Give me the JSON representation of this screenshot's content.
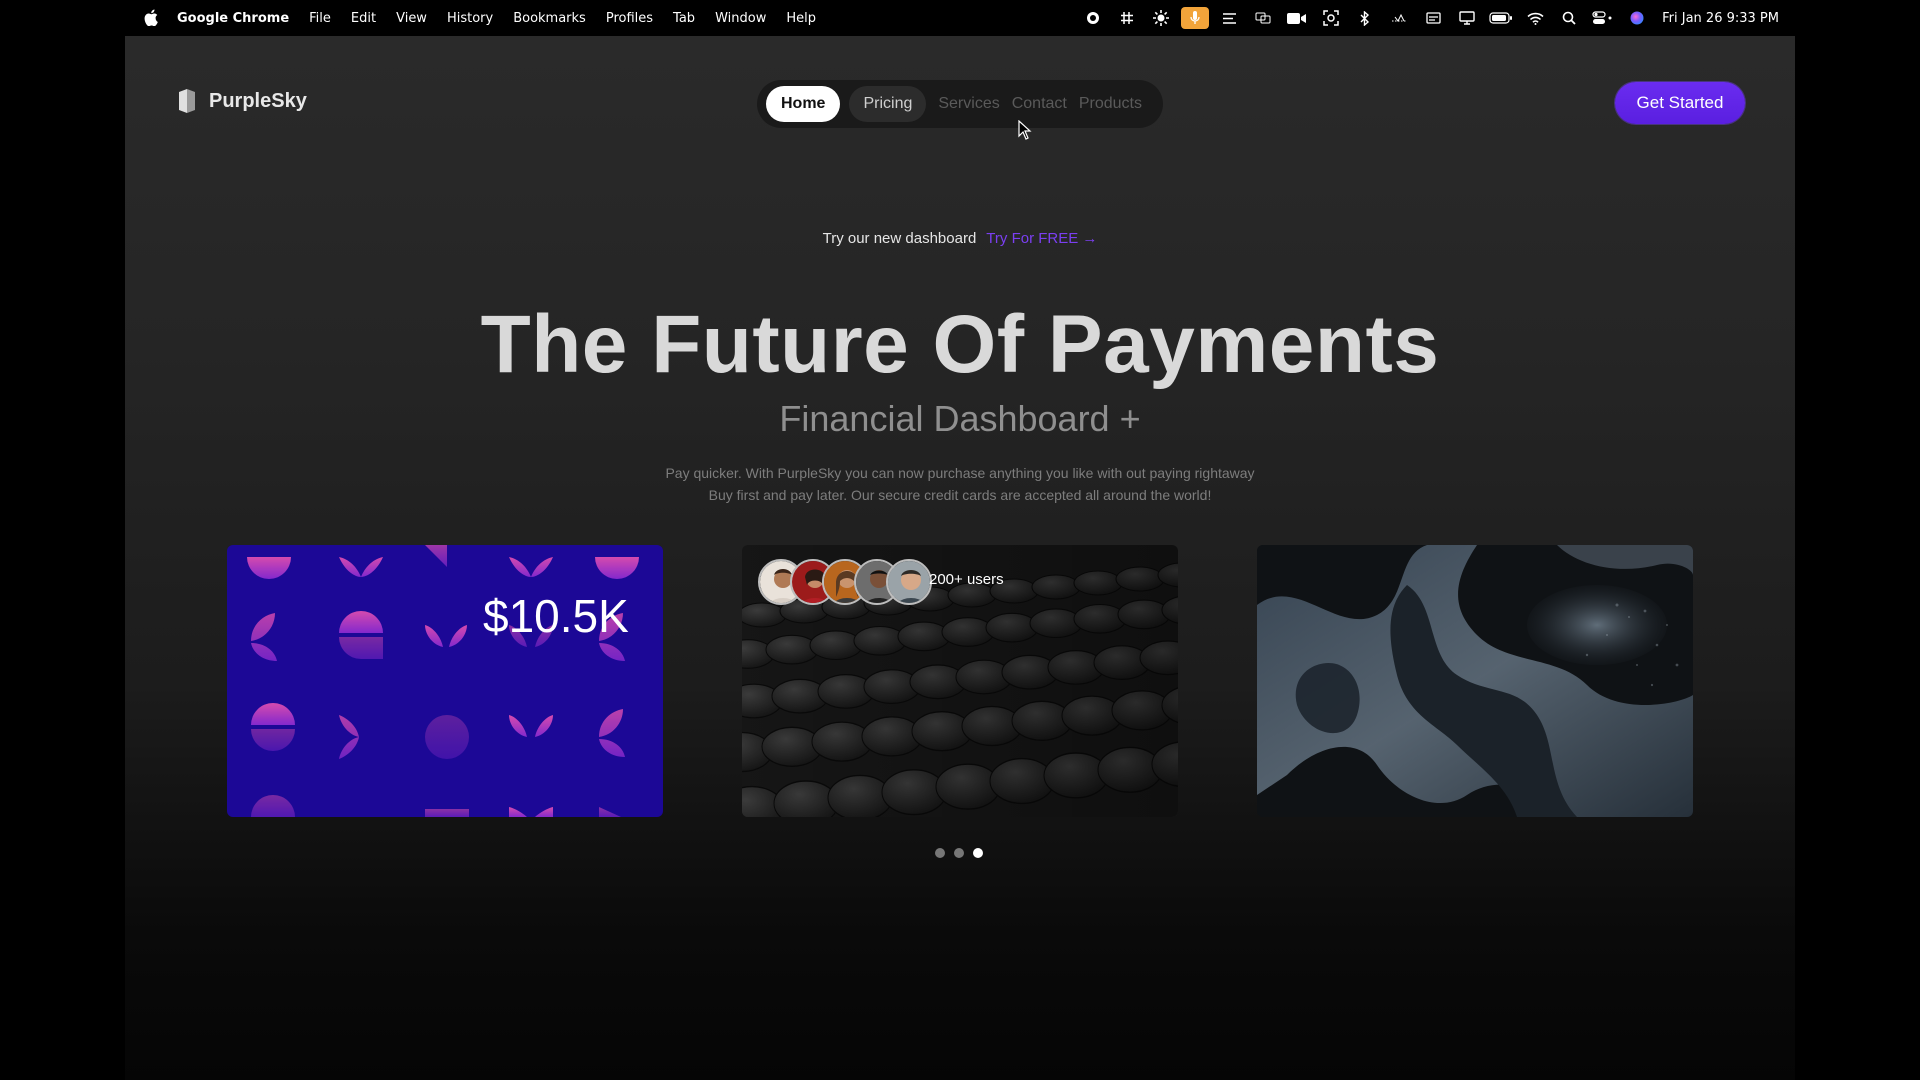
{
  "menubar": {
    "app_name": "Google Chrome",
    "menus": [
      "File",
      "Edit",
      "View",
      "History",
      "Bookmarks",
      "Profiles",
      "Tab",
      "Window",
      "Help"
    ],
    "clock": "Fri Jan 26  9:33 PM",
    "status_icons": [
      "record-icon",
      "hash-icon",
      "gear-sun-icon",
      "microphone-icon",
      "list-icon",
      "mirror-icon",
      "camera-icon",
      "screenshot-icon",
      "bluetooth-icon",
      "dots-icon",
      "display-icon",
      "monitor-icon",
      "battery-icon",
      "wifi-icon",
      "search-icon",
      "control-center-icon",
      "siri-icon"
    ],
    "accent": "#f2a43a"
  },
  "site": {
    "brand": "PurpleSky",
    "nav": {
      "home": "Home",
      "pricing": "Pricing",
      "services": "Services",
      "contact": "Contact",
      "products": "Products"
    },
    "cta": "Get Started",
    "promo_text": "Try our new dashboard",
    "promo_link": "Try For FREE →",
    "title": "The Future Of Payments",
    "subtitle": "Financial Dashboard +",
    "description_line1": "Pay quicker. With PurpleSky you can now purchase anything you like with out paying rightaway",
    "description_line2": "Buy first and pay later. Our secure credit cards are accepted all around the world!",
    "cards": {
      "amount": "$10.5K",
      "users": "200+ users"
    },
    "carousel": {
      "count": 3,
      "active_index": 3
    },
    "colors": {
      "brand_purple": "#5a1fe0",
      "link_purple": "#7b3ff2",
      "card_blue": "#1c0896"
    }
  }
}
